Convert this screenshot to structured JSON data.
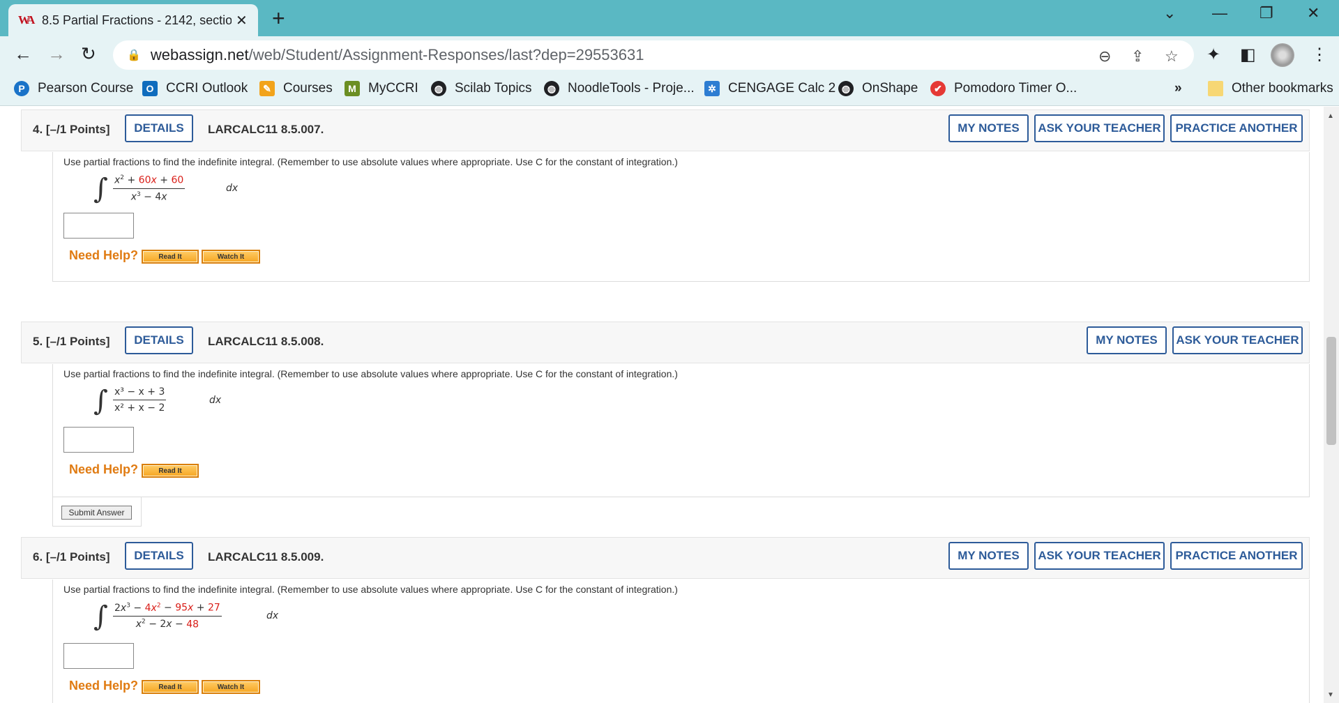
{
  "browser": {
    "tab_title": "8.5 Partial Fractions - 2142, sectio",
    "favicon": "WA",
    "url_domain": "webassign.net",
    "url_path": "/web/Student/Assignment-Responses/last?dep=29553631",
    "bookmarks": [
      {
        "label": "Pearson Course",
        "icon": "P",
        "color": "#1a73c8"
      },
      {
        "label": "CCRI Outlook",
        "icon": "O",
        "color": "#0f6cbd"
      },
      {
        "label": "Courses",
        "icon": "✎",
        "color": "#f2a31b"
      },
      {
        "label": "MyCCRI",
        "icon": "M",
        "color": "#6b8e23"
      },
      {
        "label": "Scilab Topics",
        "icon": "◍",
        "color": "#202124"
      },
      {
        "label": "NoodleTools - Proje...",
        "icon": "◍",
        "color": "#202124"
      },
      {
        "label": "CENGAGE Calc 2",
        "icon": "✲",
        "color": "#2d7dd2"
      },
      {
        "label": "OnShape",
        "icon": "◍",
        "color": "#202124"
      },
      {
        "label": "Pomodoro Timer O...",
        "icon": "✔",
        "color": "#e53935"
      }
    ],
    "overflow": "»",
    "other_bookmarks": "Other bookmarks"
  },
  "questions": [
    {
      "number": "4.",
      "points": "[–/1 Points]",
      "details": "DETAILS",
      "code": "LARCALC11 8.5.007.",
      "my_notes": "MY NOTES",
      "ask_teacher": "ASK YOUR TEACHER",
      "practice": "PRACTICE ANOTHER",
      "prompt": "Use partial fractions to find the indefinite integral. (Remember to use absolute values where appropriate. Use C for the constant of integration.)",
      "numerator_html": "x² + 60x + 60",
      "denominator_html": "x³ − 4x",
      "dx": "dx",
      "need_help": "Need Help?",
      "read_it": "Read It",
      "watch_it": "Watch It"
    },
    {
      "number": "5.",
      "points": "[–/1 Points]",
      "details": "DETAILS",
      "code": "LARCALC11 8.5.008.",
      "my_notes": "MY NOTES",
      "ask_teacher": "ASK YOUR TEACHER",
      "prompt": "Use partial fractions to find the indefinite integral. (Remember to use absolute values where appropriate. Use C for the constant of integration.)",
      "numerator_html": "x³ − x + 3",
      "denominator_html": "x² + x − 2",
      "dx": "dx",
      "need_help": "Need Help?",
      "read_it": "Read It",
      "submit": "Submit Answer"
    },
    {
      "number": "6.",
      "points": "[–/1 Points]",
      "details": "DETAILS",
      "code": "LARCALC11 8.5.009.",
      "my_notes": "MY NOTES",
      "ask_teacher": "ASK YOUR TEACHER",
      "practice": "PRACTICE ANOTHER",
      "prompt": "Use partial fractions to find the indefinite integral. (Remember to use absolute values where appropriate. Use C for the constant of integration.)",
      "numerator_html": "2x³ − 4x² − 95x + 27",
      "denominator_html": "x² − 2x − 48",
      "dx": "dx",
      "need_help": "Need Help?",
      "read_it": "Read It",
      "watch_it": "Watch It"
    }
  ]
}
